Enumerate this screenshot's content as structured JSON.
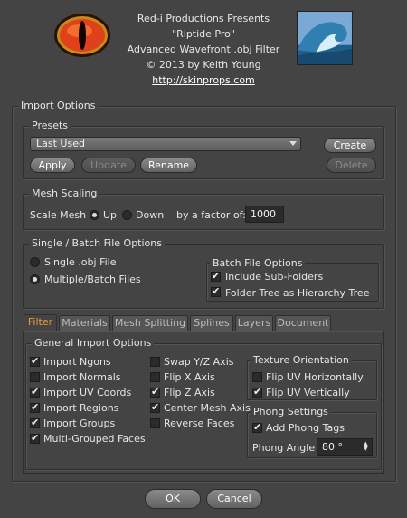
{
  "header": {
    "line1": "Red-i Productions Presents",
    "line2": "\"Riptide Pro\"",
    "line3": "Advanced Wavefront .obj Filter",
    "line4": "© 2013 by Keith Young",
    "link": "http://skinprops.com"
  },
  "import_options": {
    "title": "Import Options",
    "presets": {
      "title": "Presets",
      "selected": "Last Used",
      "create": "Create",
      "apply": "Apply",
      "update": "Update",
      "rename": "Rename",
      "delete": "Delete"
    },
    "mesh_scaling": {
      "title": "Mesh Scaling",
      "scale_label": "Scale Mesh",
      "up": "Up",
      "down": "Down",
      "factor_label": "by a factor of:",
      "factor_value": "1000"
    },
    "file_options": {
      "title": "Single / Batch File Options",
      "single": "Single .obj File",
      "multiple": "Multiple/Batch Files",
      "batch_title": "Batch File Options",
      "include_sub": "Include Sub-Folders",
      "folder_tree": "Folder Tree as Hierarchy Tree"
    }
  },
  "tabs": [
    "Filter",
    "Materials",
    "Mesh Splitting",
    "Splines",
    "Layers",
    "Document"
  ],
  "general": {
    "title": "General Import Options",
    "col1": [
      "Import Ngons",
      "Import Normals",
      "Import UV Coords",
      "Import Regions",
      "Import Groups",
      "Multi-Grouped Faces"
    ],
    "col2": [
      "Swap Y/Z Axis",
      "Flip X Axis",
      "Flip Z Axis",
      "Center Mesh Axis",
      "Reverse Faces"
    ],
    "texture_title": "Texture Orientation",
    "flip_uv_h": "Flip UV Horizontally",
    "flip_uv_v": "Flip UV Vertically",
    "phong_title": "Phong Settings",
    "add_phong": "Add Phong Tags",
    "phong_angle_label": "Phong Angle",
    "phong_angle_value": "80 °"
  },
  "footer": {
    "ok": "OK",
    "cancel": "Cancel"
  },
  "colors": {
    "background": "#444444",
    "active_tab": "#e69a3c"
  }
}
